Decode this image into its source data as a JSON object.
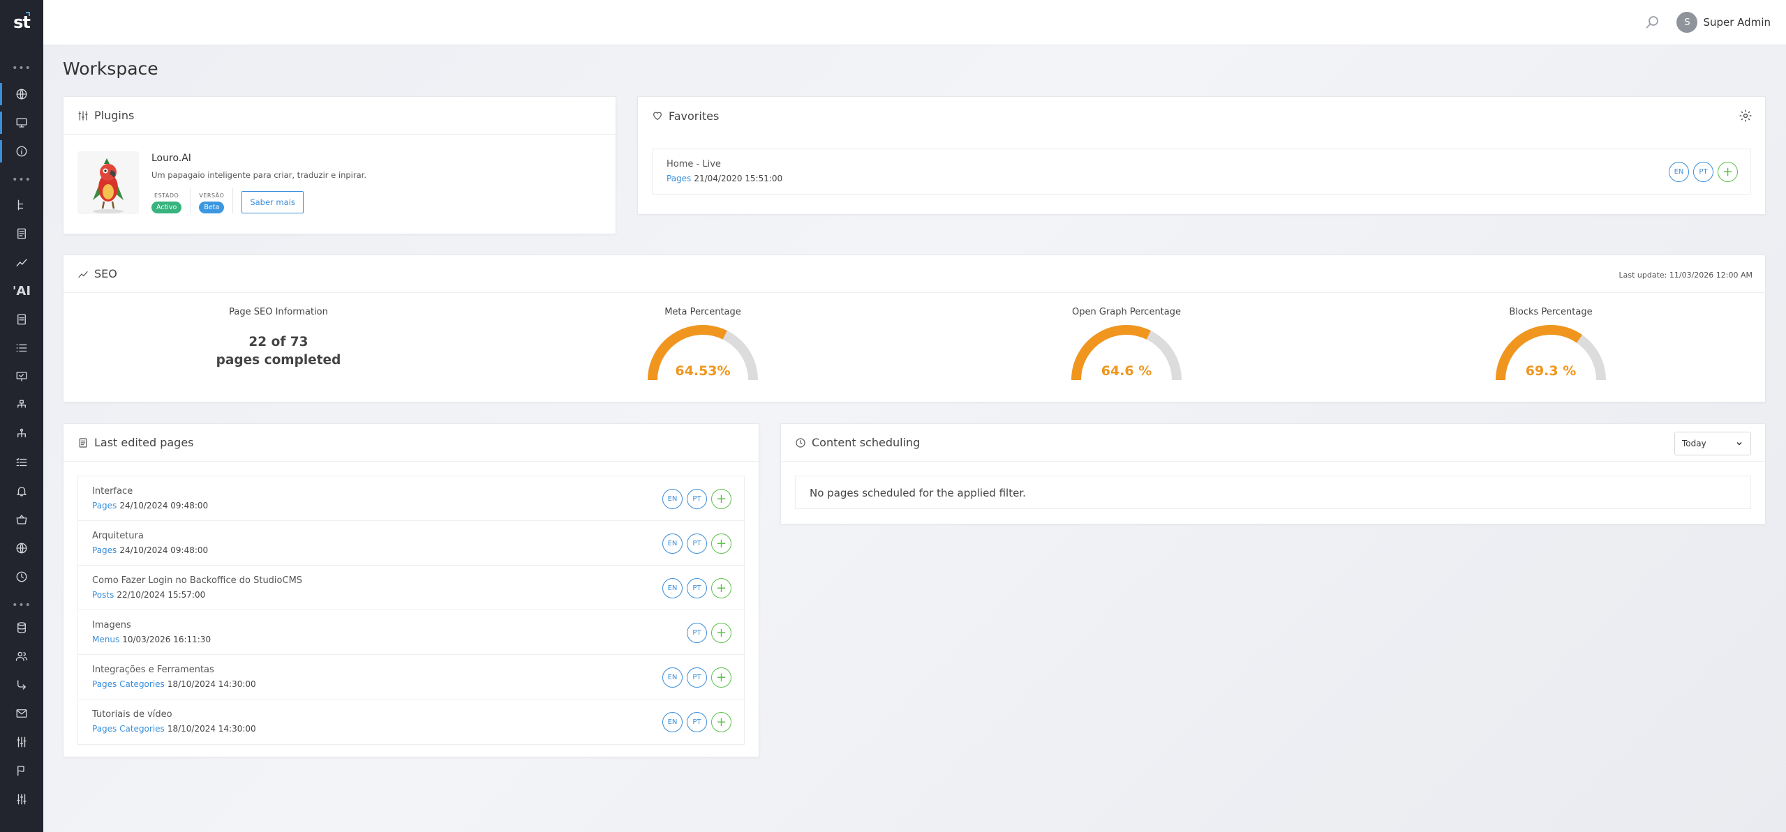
{
  "app": {
    "logo_text": "st"
  },
  "topbar": {
    "user_initial": "S",
    "user_name": "Super Admin"
  },
  "page": {
    "title": "Workspace"
  },
  "plugins": {
    "title": "Plugins",
    "items": [
      {
        "name": "Louro.AI",
        "description": "Um papagaio inteligente para criar, traduzir e inpirar.",
        "status_label": "ESTADO",
        "status_value": "Activo",
        "version_label": "VERSÃO",
        "version_value": "Beta",
        "more_button": "Saber mais"
      }
    ]
  },
  "favorites": {
    "title": "Favorites",
    "items": [
      {
        "title": "Home - Live",
        "type": "Pages",
        "date": "21/04/2020 15:51:00",
        "langs": [
          "EN",
          "PT"
        ],
        "add": "+"
      }
    ]
  },
  "seo": {
    "title": "SEO",
    "last_update": "Last update: 11/03/2026 12:00 AM",
    "page_info_label": "Page SEO Information",
    "pages_line1": "22 of 73",
    "pages_line2": "pages completed",
    "gauges": [
      {
        "label": "Meta Percentage",
        "value_text": "64.53%",
        "value": 64.53
      },
      {
        "label": "Open Graph Percentage",
        "value_text": "64.6 %",
        "value": 64.6
      },
      {
        "label": "Blocks Percentage",
        "value_text": "69.3 %",
        "value": 69.3
      }
    ],
    "colors": {
      "fill": "#f0961e",
      "track": "#dcdcdc"
    }
  },
  "last_edited": {
    "title": "Last edited pages",
    "items": [
      {
        "title": "Interface",
        "type": "Pages",
        "date": "24/10/2024 09:48:00",
        "langs": [
          "EN",
          "PT"
        ],
        "add": "+"
      },
      {
        "title": "Arquitetura",
        "type": "Pages",
        "date": "24/10/2024 09:48:00",
        "langs": [
          "EN",
          "PT"
        ],
        "add": "+"
      },
      {
        "title": "Como Fazer Login no Backoffice do StudioCMS",
        "type": "Posts",
        "date": "22/10/2024 15:57:00",
        "langs": [
          "EN",
          "PT"
        ],
        "add": "+"
      },
      {
        "title": "Imagens",
        "type": "Menus",
        "date": "10/03/2026 16:11:30",
        "langs": [
          "PT"
        ],
        "add": "+"
      },
      {
        "title": "Integrações e Ferramentas",
        "type": "Pages Categories",
        "date": "18/10/2024 14:30:00",
        "langs": [
          "EN",
          "PT"
        ],
        "add": "+"
      },
      {
        "title": "Tutoriais de vídeo",
        "type": "Pages Categories",
        "date": "18/10/2024 14:30:00",
        "langs": [
          "EN",
          "PT"
        ],
        "add": "+"
      }
    ]
  },
  "scheduling": {
    "title": "Content scheduling",
    "filter_value": "Today",
    "empty_text": "No pages scheduled for the applied filter."
  },
  "sidebar_icons": [
    "globe-icon",
    "monitor-icon",
    "info-icon",
    "tree-icon",
    "document-icon",
    "chart-icon",
    "ai-icon",
    "page-icon",
    "list-icon",
    "presentation-icon",
    "sitemap-icon",
    "hierarchy-icon",
    "checklist-icon",
    "bell-icon",
    "basket-icon",
    "world-icon",
    "clock-icon",
    "database-icon",
    "users-icon",
    "redirect-icon",
    "mail-icon",
    "sliders-icon",
    "flag-icon",
    "settings-sliders-icon"
  ]
}
